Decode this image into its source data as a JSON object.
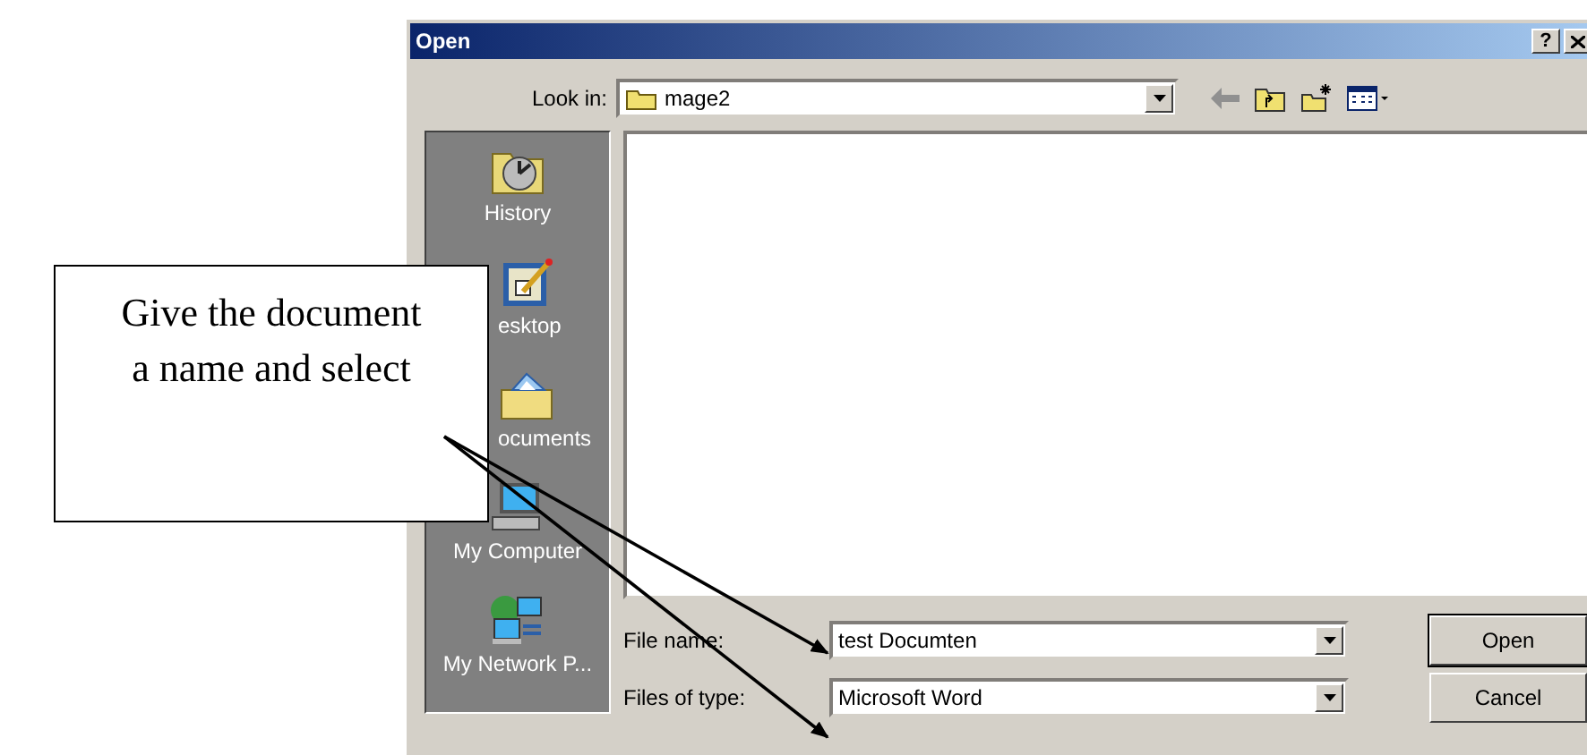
{
  "window": {
    "title": "Open",
    "help_button": "?"
  },
  "look_in": {
    "label": "Look in:",
    "value": "mage2"
  },
  "places": [
    {
      "label": "History",
      "kind": "history",
      "covered": false
    },
    {
      "label": "esktop",
      "kind": "desktop",
      "covered": true
    },
    {
      "label": "ocuments",
      "kind": "documents",
      "covered": true
    },
    {
      "label": "My Computer",
      "kind": "computer",
      "covered": false
    },
    {
      "label": "My Network P...",
      "kind": "network",
      "covered": false
    }
  ],
  "file_name": {
    "label": "File name:",
    "value": "test Documten"
  },
  "file_type": {
    "label": "Files of type:",
    "value": "Microsoft Word"
  },
  "buttons": [
    {
      "label": "Open",
      "default": true
    },
    {
      "label": "Cancel",
      "default": false
    }
  ],
  "callout": {
    "text": "Give the document a name and select"
  }
}
